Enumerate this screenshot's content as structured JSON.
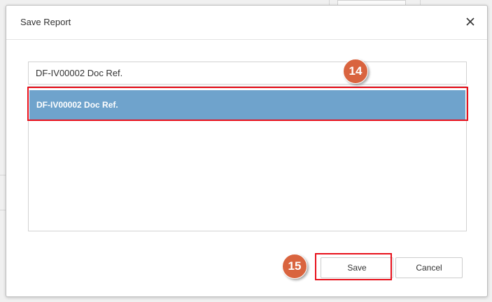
{
  "dialog": {
    "title": "Save Report",
    "close_icon": "close-icon"
  },
  "report_name_input": {
    "value": "DF-IV00002 Doc Ref."
  },
  "report_list": {
    "items": [
      {
        "label": "DF-IV00002 Doc Ref.",
        "selected": true
      }
    ]
  },
  "annotations": {
    "step_list": "14",
    "step_save": "15"
  },
  "buttons": {
    "save_label": "Save",
    "cancel_label": "Cancel"
  },
  "colors": {
    "selected_row": "#6fa3cc",
    "highlight_border": "#e8101b",
    "step_badge": "#d9643f"
  }
}
